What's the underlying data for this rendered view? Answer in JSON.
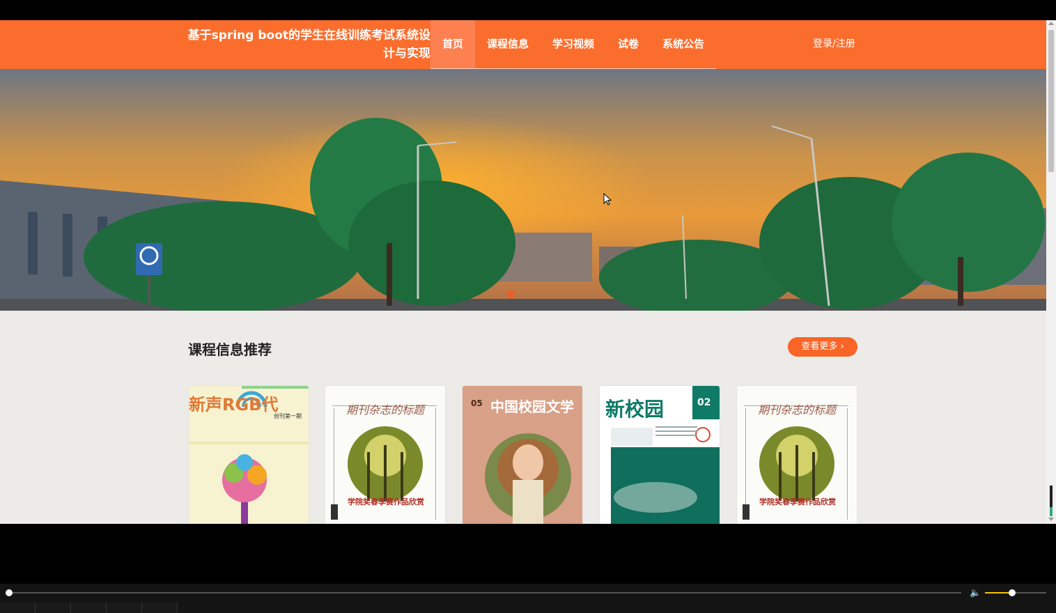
{
  "header": {
    "site_title": "基于spring boot的学生在线训练考试系统设计与实现",
    "nav": [
      {
        "label": "首页",
        "active": true
      },
      {
        "label": "课程信息",
        "active": false
      },
      {
        "label": "学习视频",
        "active": false
      },
      {
        "label": "试卷",
        "active": false
      },
      {
        "label": "系统公告",
        "active": false
      }
    ],
    "login_label": "登录/注册"
  },
  "banner": {
    "slide_count": 1,
    "active_slide": 1
  },
  "section": {
    "title": "课程信息推荐",
    "more_label": "查看更多"
  },
  "cards": [
    {
      "cover": "新声RGB代",
      "sub": "创刊第一期"
    },
    {
      "cover": "期刊杂志的标题",
      "sub": "学院奖春季赛作品欣赏"
    },
    {
      "cover": "中国校园文学",
      "sub": "05"
    },
    {
      "cover": "新校园",
      "sub": "02"
    },
    {
      "cover": "期刊杂志的标题",
      "sub": "学院奖春季赛作品欣赏"
    }
  ],
  "player": {
    "progress": 0.0,
    "volume": 0.43
  },
  "colors": {
    "header": "#fb6d2d",
    "accent": "#f96527",
    "page_bg": "#ecebe8"
  }
}
